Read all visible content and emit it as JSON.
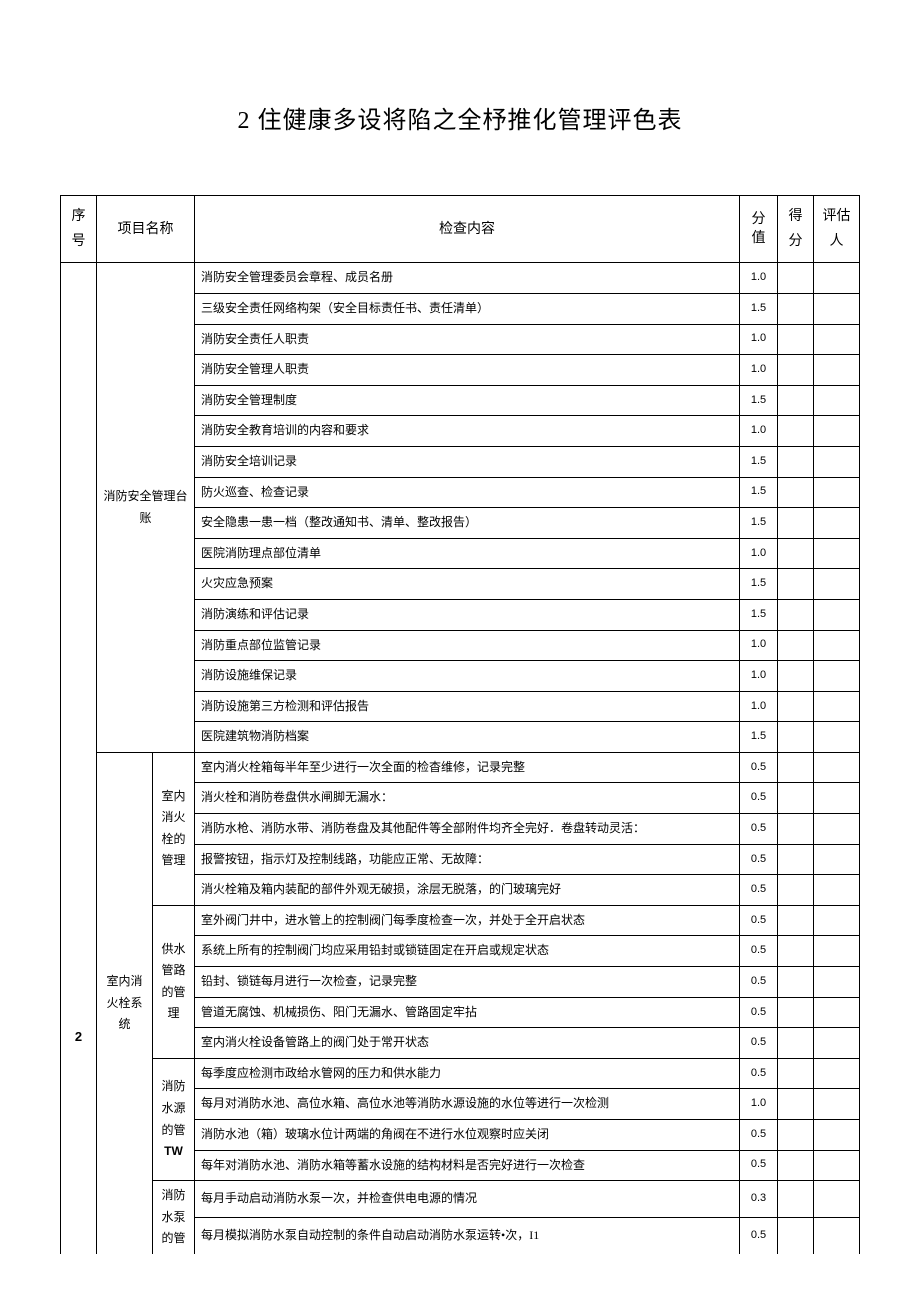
{
  "title": "2 住健康多设将陷之全杼推化管理评色表",
  "headers": {
    "seq": "序号",
    "project": "项目名称",
    "content": "检查内容",
    "score_line1": "分",
    "score_line2": "值",
    "got": "得分",
    "evaluator": "评估人"
  },
  "seq_number": "2",
  "cat1_name": "消防安全管理台账",
  "cat1_rows": [
    {
      "content": "消防安全管理委员会章程、成员名册",
      "score": "1.0"
    },
    {
      "content": "三级安全责任网络构架（安全目标责任书、责任清单）",
      "score": "1.5"
    },
    {
      "content": "消防安全责任人职责",
      "score": "1.0"
    },
    {
      "content": "消防安全管理人职责",
      "score": "1.0"
    },
    {
      "content": "消防安全管理制度",
      "score": "1.5"
    },
    {
      "content": "消防安全教育培训的内容和要求",
      "score": "1.0"
    },
    {
      "content": "消防安全培训记录",
      "score": "1.5"
    },
    {
      "content": "防火巡查、检查记录",
      "score": "1.5"
    },
    {
      "content": "安全隐患一患一档（整改通知书、清单、整改报告）",
      "score": "1.5"
    },
    {
      "content": "医院消防理点部位清单",
      "score": "1.0"
    },
    {
      "content": "火灾应急预案",
      "score": "1.5"
    },
    {
      "content": "消防演练和评估记录",
      "score": "1.5"
    },
    {
      "content": "消防重点部位监管记录",
      "score": "1.0"
    },
    {
      "content": "消防设施维保记录",
      "score": "1.0"
    },
    {
      "content": "消防设施第三方检测和评估报告",
      "score": "1.0"
    },
    {
      "content": "医院建筑物消防档案",
      "score": "1.5"
    }
  ],
  "cat2_name": "室内消火栓系统",
  "sub_a_name": "室内消火栓的管理",
  "sub_a_rows": [
    {
      "content": "室内消火栓箱每半年至少进行一次全面的检杳维修，记录完整",
      "score": "0.5"
    },
    {
      "content": "消火栓和消防卷盘供水闸脚无漏水：",
      "score": "0.5"
    },
    {
      "content": "消防水枪、消防水带、消防卷盘及其他配件等全部附件均齐全完好．卷盘转动灵活：",
      "score": "0.5"
    },
    {
      "content": "报警按钮，指示灯及控制线路，功能应正常、无故障：",
      "score": "0.5"
    },
    {
      "content": "消火栓箱及箱内装配的部件外观无破损，涂层无脱落，的门玻璃完好",
      "score": "0.5"
    }
  ],
  "sub_b_name": "供水管路的管理",
  "sub_b_rows": [
    {
      "content": "室外阀门井中，进水管上的控制阀门每季度检查一次，并处于全开启状态",
      "score": "0.5"
    },
    {
      "content": "系统上所有的控制阀门均应采用铅封或锁链固定在开启或规定状态",
      "score": "0.5"
    },
    {
      "content": "铅封、锁链每月进行一次检查，记录完整",
      "score": "0.5"
    },
    {
      "content": "管道无腐蚀、机械损伤、阳门无漏水、管路固定牢拈",
      "score": "0.5"
    },
    {
      "content": "室内消火栓设备管路上的阀门处于常开状态",
      "score": "0.5"
    }
  ],
  "sub_c_name_l1": "消防水源的管",
  "sub_c_name_l2": "TW",
  "sub_c_rows": [
    {
      "content": "每季度应检测市政给水管网的压力和供水能力",
      "score": "0.5"
    },
    {
      "content": "每月对消防水池、高位水箱、高位水池等消防水源设施的水位等进行一次检测",
      "score": "1.0"
    },
    {
      "content": "消防水池（箱）玻璃水位计两端的角阀在不进行水位观察时应关闭",
      "score": "0.5"
    },
    {
      "content": "每年对消防水池、消防水箱等蓄水设施的结构材料是否完好进行一次检查",
      "score": "0.5"
    }
  ],
  "sub_d_name": "消防水泵的管",
  "sub_d_rows": [
    {
      "content": "每月手动启动消防水泵一次，并检查供电电源的情况",
      "score": "0.3"
    },
    {
      "content": "每月模拟消防水泵自动控制的条件自动启动消防水泵运转•次，I1",
      "score": "0.5"
    }
  ]
}
